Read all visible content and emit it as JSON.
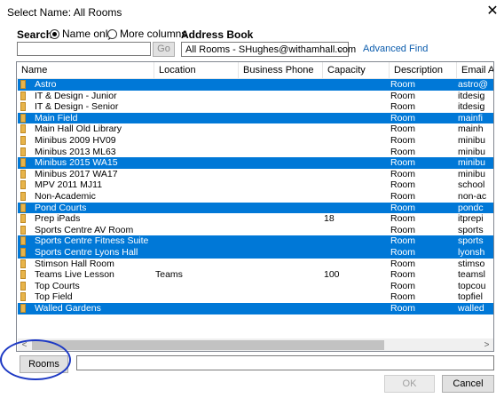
{
  "window": {
    "title": "Select Name: All Rooms",
    "close_glyph": "✕"
  },
  "search": {
    "label": "Search:",
    "option_name_only": "Name only",
    "option_more_columns": "More columns",
    "go_label": "Go",
    "input_value": "",
    "selected_option": "Name only"
  },
  "address_book": {
    "label": "Address Book",
    "selected": "All Rooms - SHughes@withamhall.com",
    "advanced_find": "Advanced Find"
  },
  "table": {
    "columns": [
      "Name",
      "Location",
      "Business Phone",
      "Capacity",
      "Description",
      "Email Ad"
    ],
    "rows": [
      {
        "name": "Astro",
        "location": "",
        "phone": "",
        "capacity": "",
        "description": "Room",
        "email": "astro@",
        "selected": true
      },
      {
        "name": "IT & Design - Junior",
        "location": "",
        "phone": "",
        "capacity": "",
        "description": "Room",
        "email": "itdesig",
        "selected": false
      },
      {
        "name": "IT & Design - Senior",
        "location": "",
        "phone": "",
        "capacity": "",
        "description": "Room",
        "email": "itdesig",
        "selected": false
      },
      {
        "name": "Main Field",
        "location": "",
        "phone": "",
        "capacity": "",
        "description": "Room",
        "email": "mainfi",
        "selected": true
      },
      {
        "name": "Main Hall Old Library",
        "location": "",
        "phone": "",
        "capacity": "",
        "description": "Room",
        "email": "mainh",
        "selected": false
      },
      {
        "name": "Minibus 2009 HV09",
        "location": "",
        "phone": "",
        "capacity": "",
        "description": "Room",
        "email": "minibu",
        "selected": false
      },
      {
        "name": "Minibus 2013 ML63",
        "location": "",
        "phone": "",
        "capacity": "",
        "description": "Room",
        "email": "minibu",
        "selected": false
      },
      {
        "name": "Minibus 2015 WA15",
        "location": "",
        "phone": "",
        "capacity": "",
        "description": "Room",
        "email": "minibu",
        "selected": true
      },
      {
        "name": "Minibus 2017 WA17",
        "location": "",
        "phone": "",
        "capacity": "",
        "description": "Room",
        "email": "minibu",
        "selected": false
      },
      {
        "name": "MPV 2011 MJ11",
        "location": "",
        "phone": "",
        "capacity": "",
        "description": "Room",
        "email": "school",
        "selected": false
      },
      {
        "name": "Non-Academic",
        "location": "",
        "phone": "",
        "capacity": "",
        "description": "Room",
        "email": "non-ac",
        "selected": false
      },
      {
        "name": "Pond Courts",
        "location": "",
        "phone": "",
        "capacity": "",
        "description": "Room",
        "email": "pondc",
        "selected": true
      },
      {
        "name": "Prep iPads",
        "location": "",
        "phone": "",
        "capacity": "18",
        "description": "Room",
        "email": "itprepi",
        "selected": false
      },
      {
        "name": "Sports Centre AV Room",
        "location": "",
        "phone": "",
        "capacity": "",
        "description": "Room",
        "email": "sports",
        "selected": false
      },
      {
        "name": "Sports Centre Fitness Suite",
        "location": "",
        "phone": "",
        "capacity": "",
        "description": "Room",
        "email": "sports",
        "selected": true
      },
      {
        "name": "Sports Centre Lyons Hall",
        "location": "",
        "phone": "",
        "capacity": "",
        "description": "Room",
        "email": "lyonsh",
        "selected": true
      },
      {
        "name": "Stimson Hall Room",
        "location": "",
        "phone": "",
        "capacity": "",
        "description": "Room",
        "email": "stimso",
        "selected": false
      },
      {
        "name": "Teams Live Lesson",
        "location": "Teams",
        "phone": "",
        "capacity": "100",
        "description": "Room",
        "email": "teamsl",
        "selected": false
      },
      {
        "name": "Top Courts",
        "location": "",
        "phone": "",
        "capacity": "",
        "description": "Room",
        "email": "topcou",
        "selected": false
      },
      {
        "name": "Top Field",
        "location": "",
        "phone": "",
        "capacity": "",
        "description": "Room",
        "email": "topfiel",
        "selected": false
      },
      {
        "name": "Walled Gardens",
        "location": "",
        "phone": "",
        "capacity": "",
        "description": "Room",
        "email": "walled",
        "selected": true
      }
    ]
  },
  "scrollbar": {
    "left_glyph": "<",
    "right_glyph": ">"
  },
  "rooms_button": {
    "label": "Rooms"
  },
  "rooms_field_value": "",
  "footer": {
    "ok_label": "OK",
    "cancel_label": "Cancel"
  },
  "colors": {
    "selection": "#0078d7",
    "link": "#0b5cad",
    "annotation": "#1d39c4"
  }
}
